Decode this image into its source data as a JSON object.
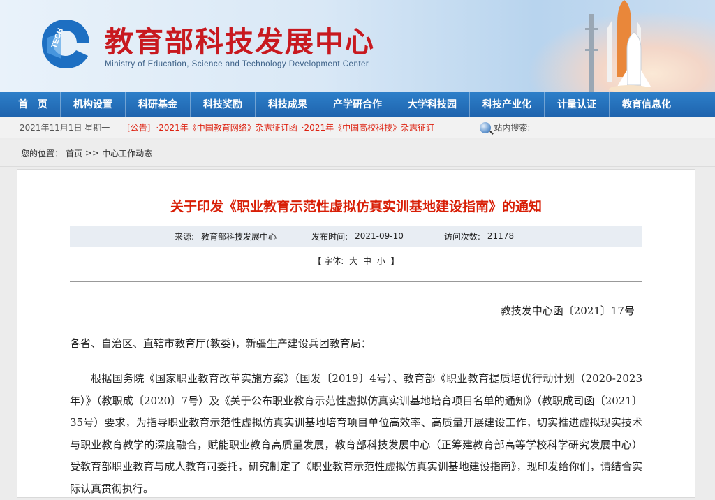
{
  "header": {
    "title": "教育部科技发展中心",
    "subtitle": "Ministry of Education, Science and Technology Development Center",
    "logo_text": "TECH",
    "colors": {
      "title": "#c8191f",
      "nav": "#1e63ad"
    }
  },
  "nav": {
    "items": [
      "首　页",
      "机构设置",
      "科研基金",
      "科技奖励",
      "科技成果",
      "产学研合作",
      "大学科技园",
      "科技产业化",
      "计量认证",
      "教育信息化"
    ]
  },
  "infobar": {
    "date": "2021年11月1日 星期一",
    "notice_tag": "[公告]",
    "notices": [
      "·2021年《中国教育网络》杂志征订函",
      "·2021年《中国高校科技》杂志征订"
    ],
    "search_label": "站内搜索:"
  },
  "breadcrumb": {
    "prefix": "您的位置：",
    "home": "首页",
    "sep": ">>",
    "current": "中心工作动态"
  },
  "article": {
    "title": "关于印发《职业教育示范性虚拟仿真实训基地建设指南》的通知",
    "source_label": "来源:",
    "source": "教育部科技发展中心",
    "date_label": "发布时间:",
    "date": "2021-09-10",
    "visits_label": "访问次数:",
    "visits": "21178",
    "font_label": "【 字体:",
    "font_large": "大",
    "font_medium": "中",
    "font_small": "小",
    "font_end": "】",
    "doc_no": "教技发中心函〔2021〕17号",
    "salutation": "各省、自治区、直辖市教育厅(教委)，新疆生产建设兵团教育局：",
    "paragraph": "根据国务院《国家职业教育改革实施方案》（国发〔2019〕4号）、教育部《职业教育提质培优行动计划（2020-2023年）》（教职成〔2020〕7号）及《关于公布职业教育示范性虚拟仿真实训基地培育项目名单的通知》（教职成司函〔2021〕35号）要求，为指导职业教育示范性虚拟仿真实训基地培育项目单位高效率、高质量开展建设工作，切实推进虚拟现实技术与职业教育教学的深度融合，赋能职业教育高质量发展，教育部科技发展中心（正筹建教育部高等学校科学研究发展中心）受教育部职业教育与成人教育司委托，研究制定了《职业教育示范性虚拟仿真实训基地建设指南》，现印发给你们，请结合实际认真贯彻执行。"
  }
}
